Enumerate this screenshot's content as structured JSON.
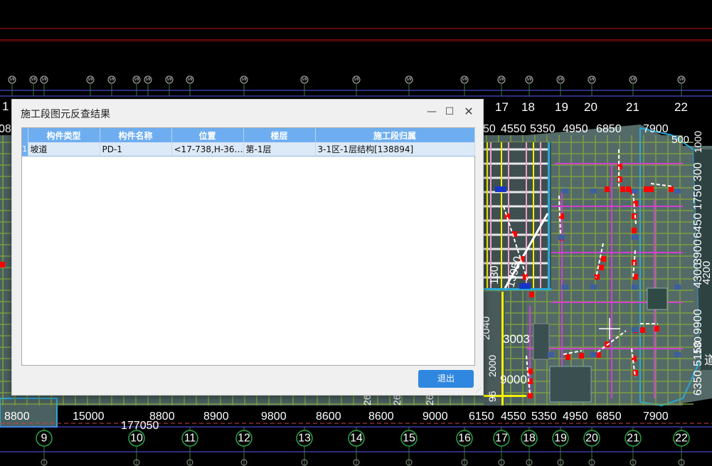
{
  "dialog": {
    "title": "施工段图元反查结果",
    "minimize_icon": "minimize-icon",
    "maximize_icon": "maximize-icon",
    "close_icon": "close-icon",
    "columns": [
      "构件类型",
      "构件名称",
      "位置",
      "楼层",
      "施工段归属"
    ],
    "rows": [
      {
        "index": "1",
        "type": "坡道",
        "name": "PD-1",
        "position": "<17-738,H-36…",
        "floor": "第-1层",
        "segment": "3-1区-1层结构[138894]"
      }
    ],
    "exit_label": "退出"
  },
  "cad": {
    "top_axis_labels": [
      "17",
      "18",
      "19",
      "20",
      "21",
      "22"
    ],
    "top_edge_label": "1",
    "top_edge_label_left": "08",
    "top_dims": [
      "50",
      "4550",
      "5350",
      "4950",
      "6850",
      "7900"
    ],
    "top_right_dim": "500",
    "right_dims": [
      "1000",
      "300",
      "1750",
      "6450",
      "3900",
      "4300",
      "4200",
      "9900",
      "5150",
      "6350",
      "130"
    ],
    "right_edge_label": "道",
    "inner_texts": [
      "130",
      "13950",
      "2040",
      "3003",
      "9000",
      "2000",
      "96"
    ],
    "bottom_dims": [
      "8800",
      "15000",
      "8800",
      "8900",
      "9800",
      "8600",
      "8600",
      "9000",
      "6150",
      "4550",
      "5350",
      "4950",
      "6850",
      "7900"
    ],
    "bottom_total": "177050",
    "bottom_rotated": [
      "26",
      "26",
      "26"
    ],
    "bottom_axis_labels": [
      "9",
      "10",
      "11",
      "12",
      "13",
      "14",
      "15",
      "16",
      "17",
      "18",
      "19",
      "20",
      "21",
      "22"
    ],
    "small_bubbles": [
      "1/9",
      "1/9",
      "1/9",
      "1/9",
      "1/9",
      "1/9",
      "1/9",
      "1/9",
      "1/9",
      "1/9",
      "1/9",
      "1/9",
      "1/9",
      "1/9",
      "1/9",
      "1/9",
      "1/9",
      "1/9",
      "1/9",
      "1/9"
    ],
    "colors": {
      "grid_green": "#7d9e40",
      "magenta": "#d040d0",
      "slab": "#4b6060",
      "yellow": "#f5f000",
      "cyan": "#28a8d8",
      "red": "#ff0000",
      "axis": "#3a7a3a"
    }
  }
}
